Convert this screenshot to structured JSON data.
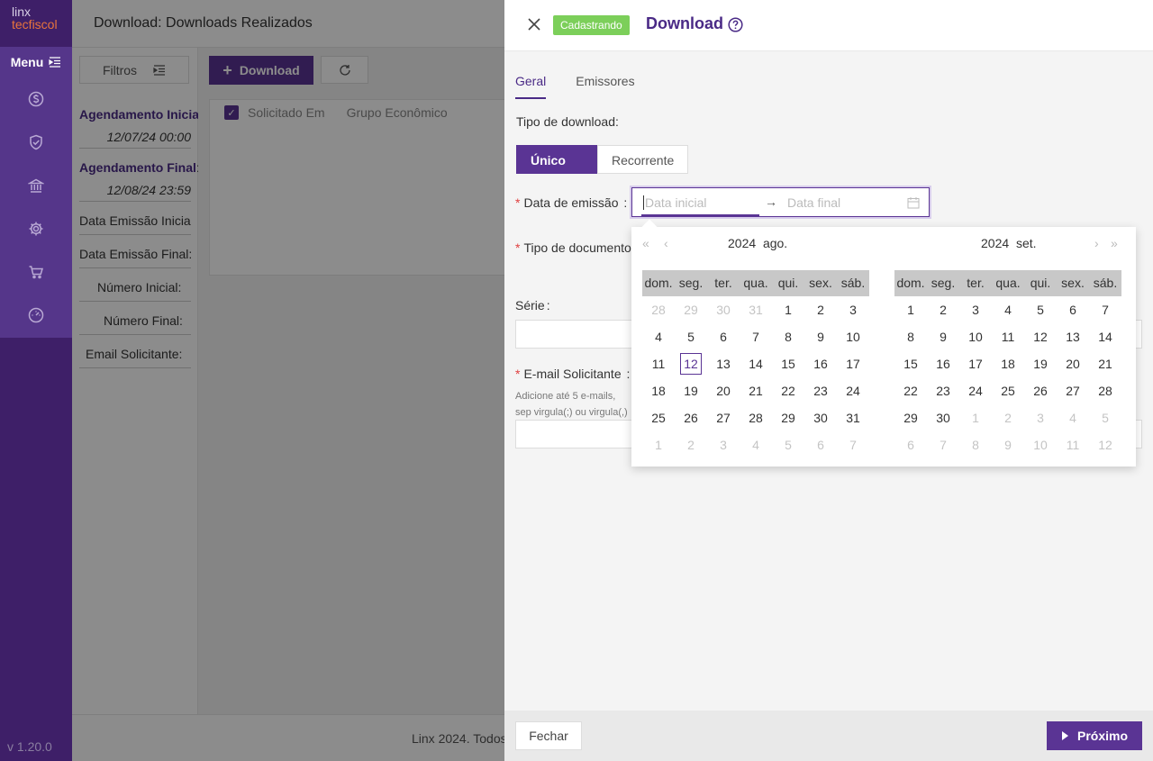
{
  "app": {
    "logo_line1": "linx",
    "logo_line2": "tecfiscol",
    "menu_label": "Menu",
    "version": "v 1.20.0",
    "nav_icons": [
      "dollar-icon",
      "shield-check-icon",
      "bank-icon",
      "gear-icon",
      "cart-icon",
      "dashboard-icon"
    ]
  },
  "page": {
    "title": "Download: Downloads Realizados",
    "footer_text": "Linx 2024. Todos"
  },
  "filters": {
    "button_label": "Filtros",
    "agendamento_inicial_label": "Agendamento Inicia",
    "agendamento_inicial_value": "12/07/24 00:00",
    "agendamento_final_label": "Agendamento Final",
    "agendamento_final_value": "12/08/24 23:59",
    "data_emissao_inicial_label": "Data Emissão Inicia",
    "data_emissao_final_label": "Data Emissão Final",
    "numero_inicial_label": "Número Inicial",
    "numero_final_label": "Número Final",
    "email_solicitante_label": "Email Solicitante",
    "colon": ":"
  },
  "toolbar": {
    "download_label": "Download",
    "plus": "+"
  },
  "grid": {
    "columns": [
      "Solicitado Em",
      "Grupo Econômico"
    ],
    "check": "✓"
  },
  "drawer": {
    "status_tag": "Cadastrando",
    "title": "Download",
    "tabs": [
      "Geral",
      "Emissores"
    ],
    "tipo_download_label": "Tipo de download:",
    "tipo_options": [
      "Único",
      "Recorrente"
    ],
    "selected_tipo": "Único",
    "data_emissao_label": "Data de emissão",
    "data_inicial_placeholder": "Data inicial",
    "data_final_placeholder": "Data final",
    "range_arrow": "→",
    "tipo_documento_label": "Tipo de documento",
    "serie_label": "Série",
    "email_label": "E-mail Solicitante",
    "email_hint": "Adicione até 5 e-mails, sep virgula(;) ou virgula(,)",
    "required_mark": "*",
    "colon": ":",
    "fechar_label": "Fechar",
    "proximo_label": "Próximo"
  },
  "datepicker": {
    "left": {
      "year": "2024",
      "month": "ago.",
      "weekdays": [
        "dom.",
        "seg.",
        "ter.",
        "qua.",
        "qui.",
        "sex.",
        "sáb."
      ],
      "weeks": [
        [
          "28",
          "29",
          "30",
          "31",
          "1",
          "2",
          "3"
        ],
        [
          "4",
          "5",
          "6",
          "7",
          "8",
          "9",
          "10"
        ],
        [
          "11",
          "12",
          "13",
          "14",
          "15",
          "16",
          "17"
        ],
        [
          "18",
          "19",
          "20",
          "21",
          "22",
          "23",
          "24"
        ],
        [
          "25",
          "26",
          "27",
          "28",
          "29",
          "30",
          "31"
        ],
        [
          "1",
          "2",
          "3",
          "4",
          "5",
          "6",
          "7"
        ]
      ],
      "muted": [
        [
          0,
          0
        ],
        [
          0,
          1
        ],
        [
          0,
          2
        ],
        [
          0,
          3
        ],
        [
          5,
          0
        ],
        [
          5,
          1
        ],
        [
          5,
          2
        ],
        [
          5,
          3
        ],
        [
          5,
          4
        ],
        [
          5,
          5
        ],
        [
          5,
          6
        ]
      ],
      "today": [
        2,
        1
      ]
    },
    "right": {
      "year": "2024",
      "month": "set.",
      "weekdays": [
        "dom.",
        "seg.",
        "ter.",
        "qua.",
        "qui.",
        "sex.",
        "sáb."
      ],
      "weeks": [
        [
          "1",
          "2",
          "3",
          "4",
          "5",
          "6",
          "7"
        ],
        [
          "8",
          "9",
          "10",
          "11",
          "12",
          "13",
          "14"
        ],
        [
          "15",
          "16",
          "17",
          "18",
          "19",
          "20",
          "21"
        ],
        [
          "22",
          "23",
          "24",
          "25",
          "26",
          "27",
          "28"
        ],
        [
          "29",
          "30",
          "1",
          "2",
          "3",
          "4",
          "5"
        ],
        [
          "6",
          "7",
          "8",
          "9",
          "10",
          "11",
          "12"
        ]
      ],
      "muted": [
        [
          4,
          2
        ],
        [
          4,
          3
        ],
        [
          4,
          4
        ],
        [
          4,
          5
        ],
        [
          4,
          6
        ],
        [
          5,
          0
        ],
        [
          5,
          1
        ],
        [
          5,
          2
        ],
        [
          5,
          3
        ],
        [
          5,
          4
        ],
        [
          5,
          5
        ],
        [
          5,
          6
        ]
      ],
      "today": null
    },
    "nav_prev_year": "«",
    "nav_prev_month": "‹",
    "nav_next_month": "›",
    "nav_next_year": "»"
  },
  "colors": {
    "brand_purple": "#5a3494",
    "sidebar": "#3e1f68",
    "tag_green": "#7ccf5a",
    "required_red": "#e04040"
  }
}
